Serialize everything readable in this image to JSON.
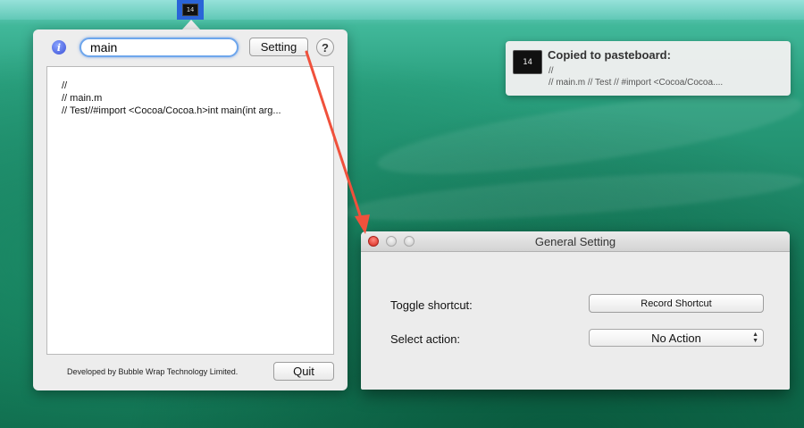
{
  "menubar": {
    "status_icon_text": "14"
  },
  "popover": {
    "search_value": "main",
    "setting_label": "Setting",
    "help_label": "?",
    "content_lines": [
      "//",
      "//  main.m",
      "//  Test//#import <Cocoa/Cocoa.h>int main(int arg..."
    ],
    "footer_text": "Developed by Bubble Wrap Technology Limited.",
    "quit_label": "Quit"
  },
  "notification": {
    "icon_text": "14",
    "title": "Copied to pasteboard:",
    "line1": "//",
    "line2": "//  main.m //  Test //  #import <Cocoa/Cocoa...."
  },
  "settings_window": {
    "title": "General Setting",
    "toggle_label": "Toggle shortcut:",
    "record_button_label": "Record Shortcut",
    "action_label": "Select action:",
    "action_selected": "No Action"
  },
  "colors": {
    "arrow": "#f0513c",
    "accent": "#2a64d8"
  }
}
